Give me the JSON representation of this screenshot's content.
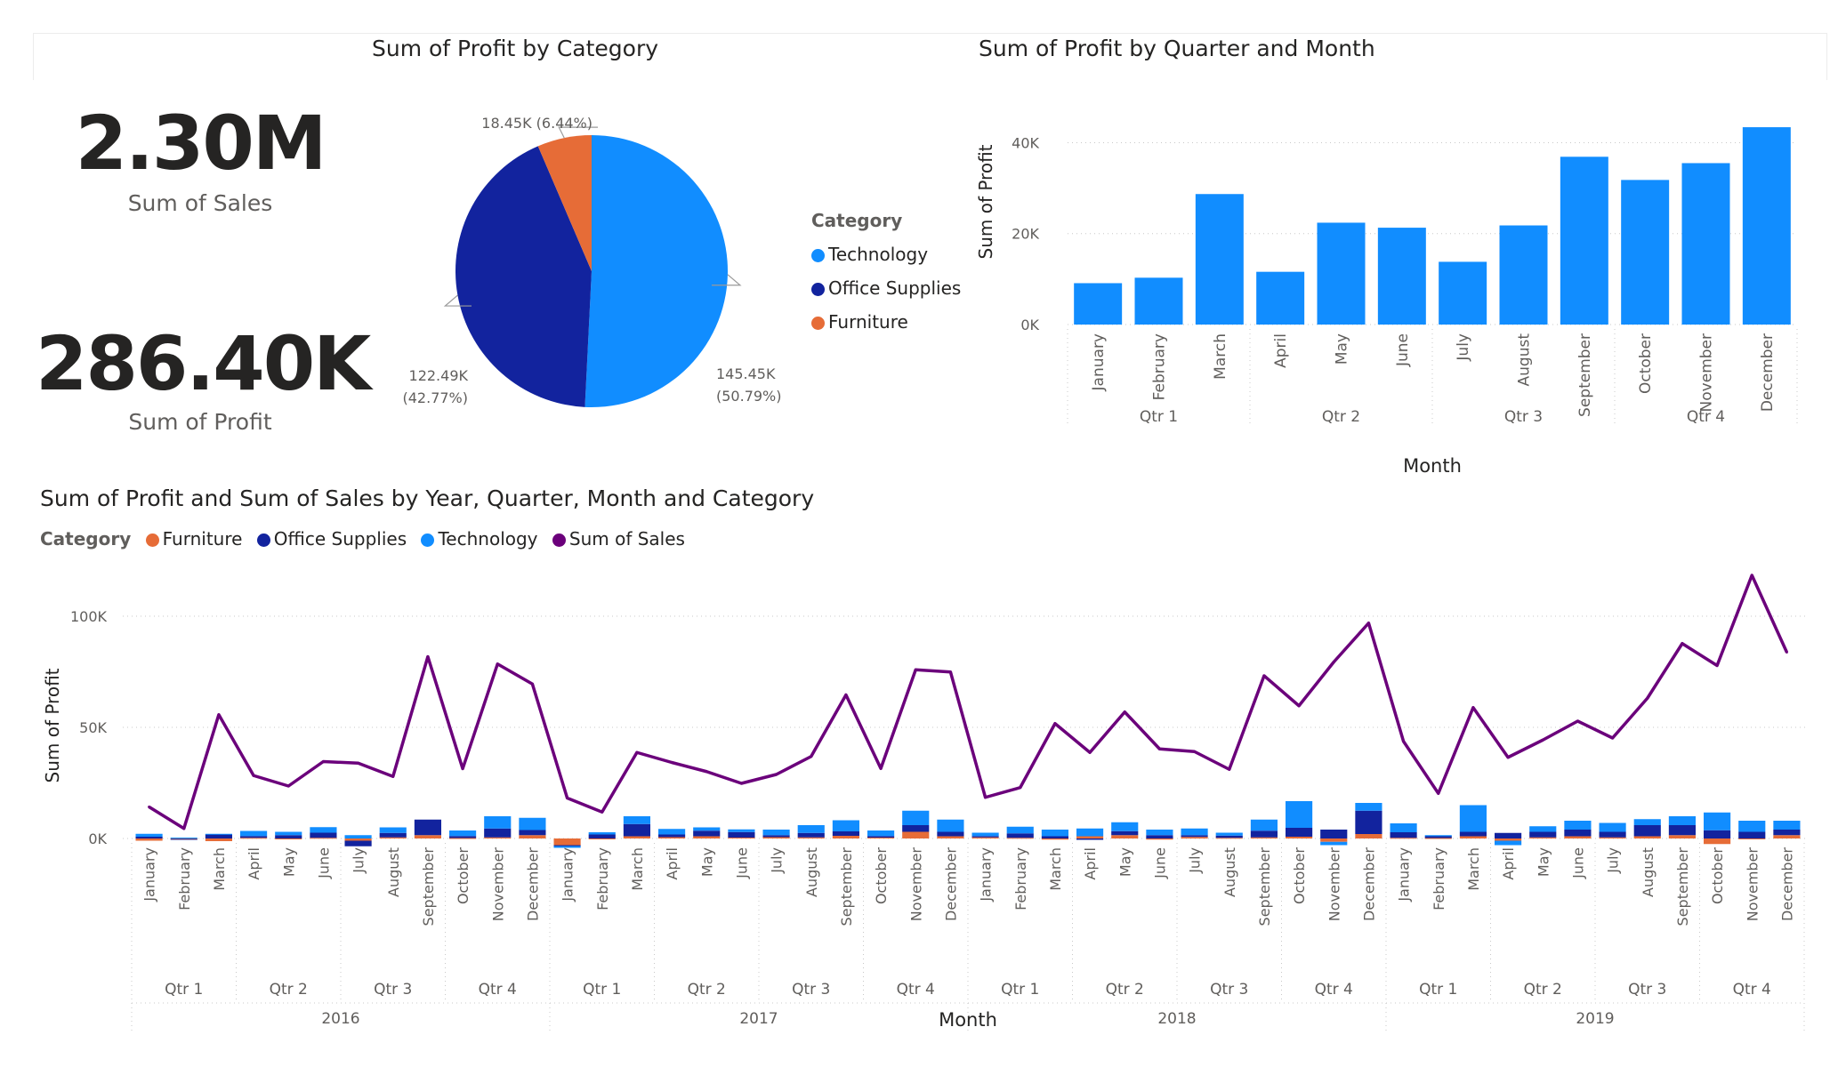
{
  "pie_title": "Sum of Profit by Category",
  "bar_title": "Sum of Profit by Quarter and Month",
  "combo_title": "Sum of Profit and Sum of Sales by Year, Quarter, Month and Category",
  "kpis": {
    "sales_value": "2.30M",
    "sales_label": "Sum of Sales",
    "profit_value": "286.40K",
    "profit_label": "Sum of Profit"
  },
  "colors": {
    "technology": "#118dff",
    "office_supplies": "#12239e",
    "furniture": "#e66c37",
    "sales_line": "#6b007b"
  },
  "pie_legend": {
    "title": "Category",
    "items": [
      "Technology",
      "Office Supplies",
      "Furniture"
    ]
  },
  "combo_legend": {
    "title": "Category",
    "items": [
      "Furniture",
      "Office Supplies",
      "Technology",
      "Sum of Sales"
    ]
  },
  "chart_data": [
    {
      "type": "pie",
      "title": "Sum of Profit by Category",
      "categories": [
        "Technology",
        "Office Supplies",
        "Furniture"
      ],
      "values": [
        145450,
        122490,
        18450
      ],
      "labels": [
        "145.45K",
        "122.49K",
        "18.45K"
      ],
      "percents": [
        "50.79%",
        "42.77%",
        "6.44%"
      ],
      "label_texts": [
        "145.45K",
        "(50.79%)",
        "122.49K",
        "(42.77%)",
        "18.45K (6.44%)"
      ]
    },
    {
      "type": "bar",
      "title": "Sum of Profit by Quarter and Month",
      "xlabel": "Month",
      "ylabel": "Sum of Profit",
      "categories": [
        "January",
        "February",
        "March",
        "April",
        "May",
        "June",
        "July",
        "August",
        "September",
        "October",
        "November",
        "December"
      ],
      "quarters": [
        "Qtr 1",
        "Qtr 2",
        "Qtr 3",
        "Qtr 4"
      ],
      "values": [
        9100,
        10300,
        28700,
        11600,
        22400,
        21300,
        13800,
        21800,
        36900,
        31800,
        35500,
        43400
      ],
      "ylim": [
        0,
        44000
      ],
      "yticks": [
        "0K",
        "20K",
        "40K"
      ],
      "ytick_values": [
        0,
        20000,
        40000
      ],
      "grid": true
    },
    {
      "type": "bar",
      "title": "Sum of Profit and Sum of Sales by Year, Quarter, Month and Category",
      "xlabel": "Month",
      "ylabel": "Sum of Profit",
      "years": [
        "2016",
        "2017",
        "2018",
        "2019"
      ],
      "quarters": [
        "Qtr 1",
        "Qtr 2",
        "Qtr 3",
        "Qtr 4"
      ],
      "months": [
        "January",
        "February",
        "March",
        "April",
        "May",
        "June",
        "July",
        "August",
        "September",
        "October",
        "November",
        "December"
      ],
      "yticks": [
        "0K",
        "50K",
        "100K"
      ],
      "ytick_values": [
        0,
        50000,
        100000
      ],
      "ylim": [
        -4000,
        120000
      ],
      "grid": true,
      "series": [
        {
          "name": "Furniture",
          "values": [
            -1000,
            -200,
            -1200,
            300,
            -300,
            300,
            -1000,
            500,
            1500,
            200,
            500,
            1500,
            -3000,
            -300,
            1000,
            600,
            1000,
            400,
            600,
            500,
            1200,
            400,
            3000,
            1000,
            500,
            300,
            -500,
            1000,
            1500,
            -500,
            700,
            300,
            500,
            800,
            -1500,
            2000,
            300,
            200,
            1000,
            -1000,
            500,
            1000,
            500,
            1000,
            1500,
            -2500,
            -400,
            1500
          ]
        },
        {
          "name": "Office Supplies",
          "values": [
            800,
            -200,
            1800,
            800,
            1500,
            2300,
            -2500,
            2000,
            7000,
            900,
            4000,
            2300,
            -400,
            1800,
            5500,
            1200,
            2500,
            2500,
            900,
            2000,
            2000,
            700,
            3000,
            2000,
            600,
            2000,
            1000,
            -600,
            1800,
            1500,
            800,
            1000,
            3000,
            4000,
            4000,
            10500,
            2500,
            800,
            2000,
            2500,
            2500,
            3000,
            2500,
            5000,
            4500,
            3700,
            3000,
            2500
          ]
        },
        {
          "name": "Technology",
          "values": [
            1300,
            400,
            300,
            2300,
            1500,
            2500,
            1500,
            2500,
            0,
            2500,
            5500,
            5500,
            -800,
            1000,
            3500,
            2500,
            1500,
            1200,
            2500,
            3500,
            5000,
            2500,
            6500,
            5500,
            1500,
            3000,
            3000,
            3500,
            4000,
            2500,
            3000,
            1300,
            5000,
            12000,
            -1500,
            3500,
            4000,
            500,
            12000,
            -2000,
            2500,
            4000,
            4000,
            2700,
            4000,
            8000,
            5000,
            4000
          ]
        },
        {
          "name": "Sum of Sales",
          "values": [
            14200,
            4500,
            55700,
            28300,
            23600,
            34600,
            33900,
            27900,
            81800,
            31400,
            78500,
            69500,
            18200,
            11900,
            38700,
            34200,
            30100,
            24800,
            28800,
            36900,
            64600,
            31500,
            75900,
            74900,
            18500,
            22900,
            51700,
            38700,
            56900,
            40300,
            39100,
            31100,
            73200,
            59700,
            79400,
            96900,
            43700,
            20300,
            58900,
            36500,
            44300,
            52800,
            45200,
            63100,
            87700,
            77800,
            118400,
            83800
          ]
        }
      ]
    }
  ]
}
